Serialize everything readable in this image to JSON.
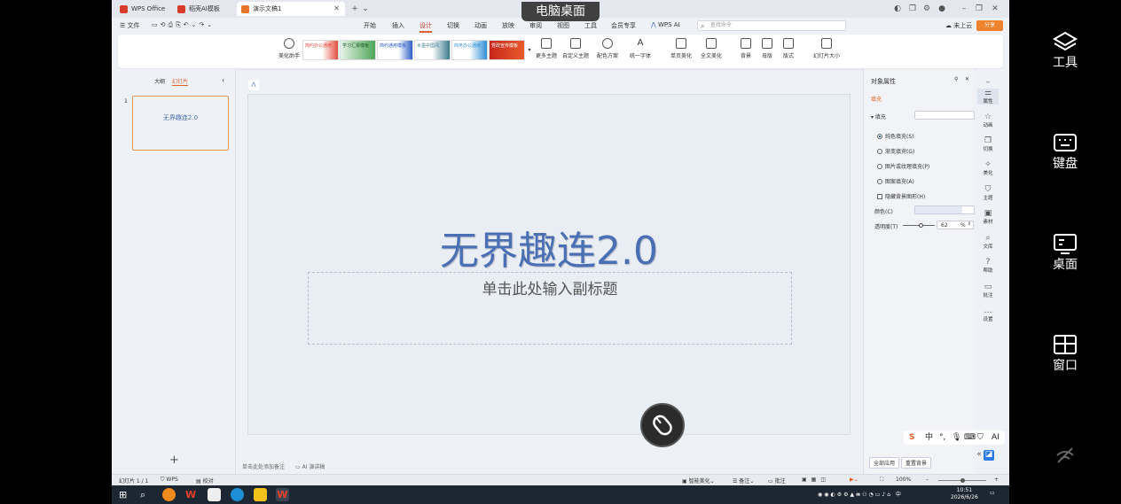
{
  "remote": {
    "title": "电脑桌面"
  },
  "right_panel": {
    "items": [
      {
        "name": "tools",
        "label": "工具"
      },
      {
        "name": "keyboard",
        "label": "键盘"
      },
      {
        "name": "desktop",
        "label": "桌面"
      },
      {
        "name": "window",
        "label": "窗口"
      }
    ]
  },
  "tabs": [
    {
      "label": "WPS Office",
      "color": "#d83b2b"
    },
    {
      "label": "稻壳AI模板",
      "color": "#d83b2b"
    },
    {
      "label": "演示文稿1",
      "color": "#e5752a",
      "active": true
    }
  ],
  "menu": {
    "file": "☰ 文件",
    "items": [
      "开始",
      "插入",
      "设计",
      "切换",
      "动画",
      "放映",
      "审阅",
      "视图",
      "工具",
      "会员专享"
    ],
    "active": "设计",
    "wps_ai": "WPS AI",
    "search_placeholder": "查找命令",
    "cloud": "未上云",
    "share": "分享"
  },
  "ribbon": {
    "beautify": "美化助手",
    "themes": [
      {
        "label": "简约办公通用",
        "color": "#e24d3b"
      },
      {
        "label": "学习汇报模板",
        "color": "#4fa65a"
      },
      {
        "label": "简约通用模板",
        "color": "#2d5ec7"
      },
      {
        "label": "水墨中国风",
        "color": "#3a7a8c"
      },
      {
        "label": "商务办公通用",
        "color": "#2f8fd6"
      },
      {
        "label": "党政宣传模板",
        "color": "#c8261d"
      }
    ],
    "buttons": [
      "更多主题",
      "自定义主题",
      "配色方案",
      "统一字体",
      "单页美化",
      "全文美化",
      "背景",
      "母版",
      "版式",
      "幻灯片大小"
    ]
  },
  "left_pane": {
    "tab_outline": "大纲",
    "tab_slides": "幻灯片",
    "slide_number": "1",
    "thumb_title": "无界趣连2.0",
    "add": "+"
  },
  "slide": {
    "title": "无界趣连2.0",
    "subtitle_placeholder": "单击此处输入副标题"
  },
  "notes": {
    "placeholder": "单击此处添加备注",
    "ai": "AI 演讲稿"
  },
  "object_pane": {
    "title": "对象属性",
    "tab": "填充",
    "section": "填充",
    "options": [
      "纯色填充(S)",
      "渐变填充(G)",
      "图片或纹理填充(P)",
      "图案填充(A)"
    ],
    "hide_bg": "隐藏背景图形(H)",
    "color_label": "颜色(C)",
    "transparency_label": "透明度(T)",
    "transparency_value": "62",
    "transparency_unit": "%",
    "apply_all": "全部应用",
    "reset_bg": "重置背景"
  },
  "side_icons": [
    "属性",
    "动画",
    "切换",
    "美化",
    "主题",
    "素材",
    "文库",
    "帮助",
    "批注",
    "设置"
  ],
  "status": {
    "slide_info": "幻灯片 1 / 1",
    "wps": "WPS",
    "proof": "校对",
    "smart": "智能美化",
    "notes": "备注",
    "comment": "批注",
    "zoom": "100%"
  },
  "ime": {
    "lang": "中"
  },
  "clock": {
    "time": "10:51",
    "date": "2026/6/26"
  },
  "colors": {
    "accent": "#e0602a",
    "title_blue": "#4a6fb5"
  }
}
